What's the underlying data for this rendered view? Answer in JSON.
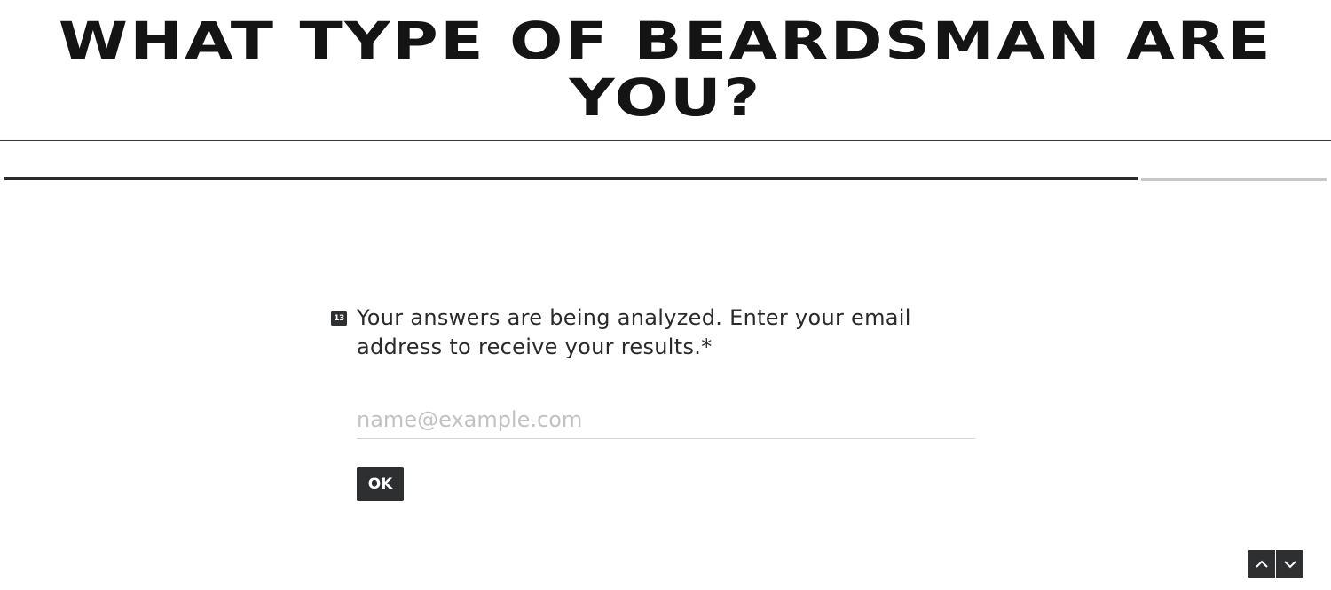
{
  "header": {
    "title": "WHAT TYPE OF BEARDSMAN ARE YOU?"
  },
  "progress": {
    "fraction": 0.857
  },
  "question": {
    "number": "13",
    "text": "Your answers are being analyzed. Enter your email address to receive your results.*"
  },
  "email_input": {
    "placeholder": "name@example.com",
    "value": ""
  },
  "submit": {
    "label": "OK"
  },
  "navigation": {
    "up_icon": "chevron-up-icon",
    "down_icon": "chevron-down-icon"
  },
  "colors": {
    "accent": "#2d2f31",
    "progress_track": "#c8c8c8",
    "placeholder": "#c2c2c2"
  }
}
